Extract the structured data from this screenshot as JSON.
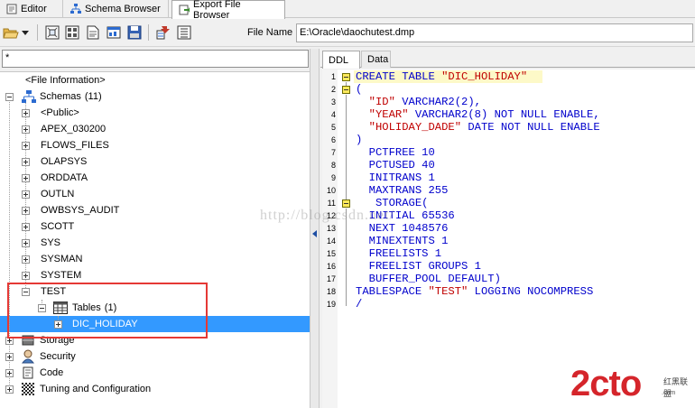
{
  "tabs": [
    {
      "label": "Editor",
      "icon": "editor-icon",
      "active": false
    },
    {
      "label": "Schema Browser",
      "icon": "schema-browser-icon",
      "active": false
    },
    {
      "label": "Export File Browser",
      "icon": "export-file-icon",
      "active": true
    }
  ],
  "toolbar": {
    "file_name_label": "File Name",
    "file_name_value": "E:\\Oracle\\daochutest.dmp"
  },
  "filter": {
    "value": "*"
  },
  "tree": {
    "file_information": "<File Information>",
    "schemas_label": "Schemas",
    "schemas_count": "(11)",
    "schemas": [
      "<Public>",
      "APEX_030200",
      "FLOWS_FILES",
      "OLAPSYS",
      "ORDDATA",
      "OUTLN",
      "OWBSYS_AUDIT",
      "SCOTT",
      "SYS",
      "SYSMAN",
      "SYSTEM",
      "TEST"
    ],
    "tables_label": "Tables",
    "tables_count": "(1)",
    "table_selected": "DIC_HOLIDAY",
    "storage": "Storage",
    "security": "Security",
    "code": "Code",
    "tuning": "Tuning and Configuration"
  },
  "right_tabs": {
    "ddl": "DDL",
    "data": "Data"
  },
  "editor": {
    "lines": [
      "CREATE TABLE \"DIC_HOLIDAY\"",
      "(",
      "  \"ID\" VARCHAR2(2),",
      "  \"YEAR\" VARCHAR2(8) NOT NULL ENABLE,",
      "  \"HOLIDAY_DADE\" DATE NOT NULL ENABLE",
      ")",
      "  PCTFREE 10",
      "  PCTUSED 40",
      "  INITRANS 1",
      "  MAXTRANS 255",
      "   STORAGE(",
      "  INITIAL 65536",
      "  NEXT 1048576",
      "  MINEXTENTS 1",
      "  FREELISTS 1",
      "  FREELIST GROUPS 1",
      "  BUFFER_POOL DEFAULT)",
      "TABLESPACE \"TEST\" LOGGING NOCOMPRESS",
      "/"
    ],
    "line_numbers": [
      "1",
      "2",
      "3",
      "4",
      "5",
      "6",
      "7",
      "8",
      "9",
      "10",
      "11",
      "12",
      "13",
      "14",
      "15",
      "16",
      "17",
      "18",
      "19"
    ]
  },
  "watermark": "http://blog.csdn.net/",
  "logo": {
    "main": "2cto",
    "sub": "红黑联盟",
    "url": ".com"
  },
  "colors": {
    "selection": "#3399ff",
    "highlight_box": "#e53935",
    "keyword": "#0000cc",
    "string": "#c00000"
  }
}
